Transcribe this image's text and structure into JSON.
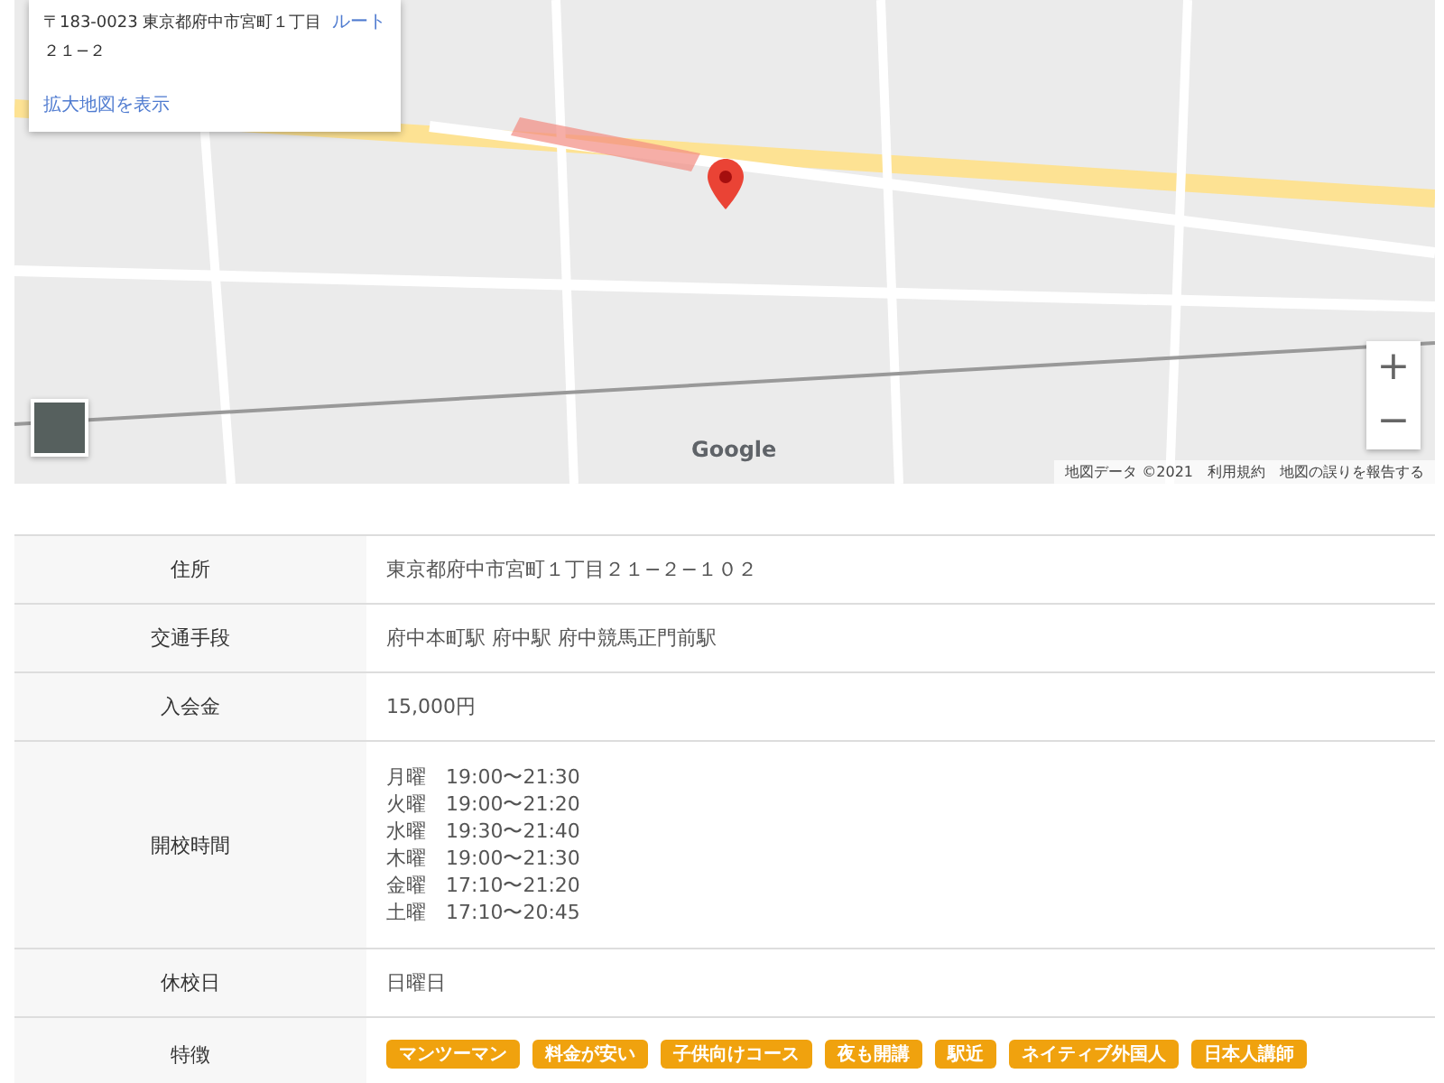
{
  "map": {
    "info_card": {
      "address_lines": [
        "〒183-0023 東京都府中市宮町１丁目",
        "２１−２"
      ],
      "route_link": "ルート",
      "larger_map_link": "拡大地図を表示"
    },
    "zoom_in": "+",
    "zoom_out": "−",
    "logo": "Google",
    "attribution": [
      "地図データ ©2021",
      "利用規約",
      "地図の誤りを報告する"
    ]
  },
  "details": [
    {
      "label": "住所",
      "kind": "text",
      "value": "東京都府中市宮町１丁目２１−２−１０２"
    },
    {
      "label": "交通手段",
      "kind": "text",
      "value": "府中本町駅 府中駅 府中競馬正門前駅"
    },
    {
      "label": "入会金",
      "kind": "text",
      "value": "15,000円"
    },
    {
      "label": "開校時間",
      "kind": "schedule",
      "lines": [
        {
          "day": "月曜",
          "time": "19:00〜21:30"
        },
        {
          "day": "火曜",
          "time": "19:00〜21:20"
        },
        {
          "day": "水曜",
          "time": "19:30〜21:40"
        },
        {
          "day": "木曜",
          "time": "19:00〜21:30"
        },
        {
          "day": "金曜",
          "time": "17:10〜21:20"
        },
        {
          "day": "土曜",
          "time": "17:10〜20:45"
        }
      ]
    },
    {
      "label": "休校日",
      "kind": "text",
      "value": "日曜日"
    },
    {
      "label": "特徴",
      "kind": "tags",
      "tags": [
        "マンツーマン",
        "料金が安い",
        "子供向けコース",
        "夜も開講",
        "駅近",
        "ネイティブ外国人",
        "日本人講師"
      ]
    }
  ]
}
